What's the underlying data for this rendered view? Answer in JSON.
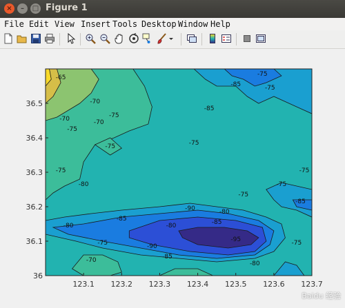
{
  "window": {
    "title": "Figure 1",
    "close_glyph": "×",
    "min_glyph": "–",
    "max_glyph": "□"
  },
  "menu": [
    "File",
    "Edit",
    "View",
    "Insert",
    "Tools",
    "Desktop",
    "Window",
    "Help"
  ],
  "toolbar_icons": [
    "new-figure-icon",
    "open-file-icon",
    "save-icon",
    "print-icon",
    "pointer-icon",
    "zoom-in-icon",
    "zoom-out-icon",
    "pan-icon",
    "rotate-3d-icon",
    "data-cursor-icon",
    "brush-icon",
    "brush-dropdown-icon",
    "link-plot-icon",
    "colorbar-icon",
    "legend-icon",
    "hide-plot-tools-icon",
    "show-plot-tools-icon"
  ],
  "chart_data": {
    "type": "contour",
    "xlim": [
      123.0,
      123.7
    ],
    "ylim": [
      36.0,
      36.6
    ],
    "x_ticks": [
      "123.1",
      "123.2",
      "123.3",
      "123.4",
      "123.5",
      "123.6",
      "123.7"
    ],
    "y_ticks": [
      "36",
      "36.1",
      "36.2",
      "36.3",
      "36.4",
      "36.5"
    ],
    "levels": [
      -95,
      -90,
      -85,
      -80,
      -75,
      -70,
      -65
    ],
    "colors": {
      "-95": "#352a87",
      "-90": "#2c4fd6",
      "-85": "#1a7ce0",
      "-80": "#1a9fd0",
      "-75": "#22b3b0",
      "-70": "#3cbd9a",
      "-65": "#8cc470",
      "-60": "#d6be48",
      "-55": "#f8d92a"
    },
    "contour_labels": [
      "-65",
      "-70",
      "-70",
      "-75",
      "-75",
      "-80",
      "-75",
      "-85",
      "-75",
      "-85",
      "-75",
      "-75",
      "-70",
      "-75",
      "-80",
      "-85",
      "-90",
      "-85",
      "-80",
      "-75",
      "-95",
      "-90",
      "-85",
      "-80",
      "-75",
      "-80",
      "-70",
      "-75",
      "-75",
      "-85",
      "-75"
    ]
  },
  "watermark": "Baidu 经验"
}
